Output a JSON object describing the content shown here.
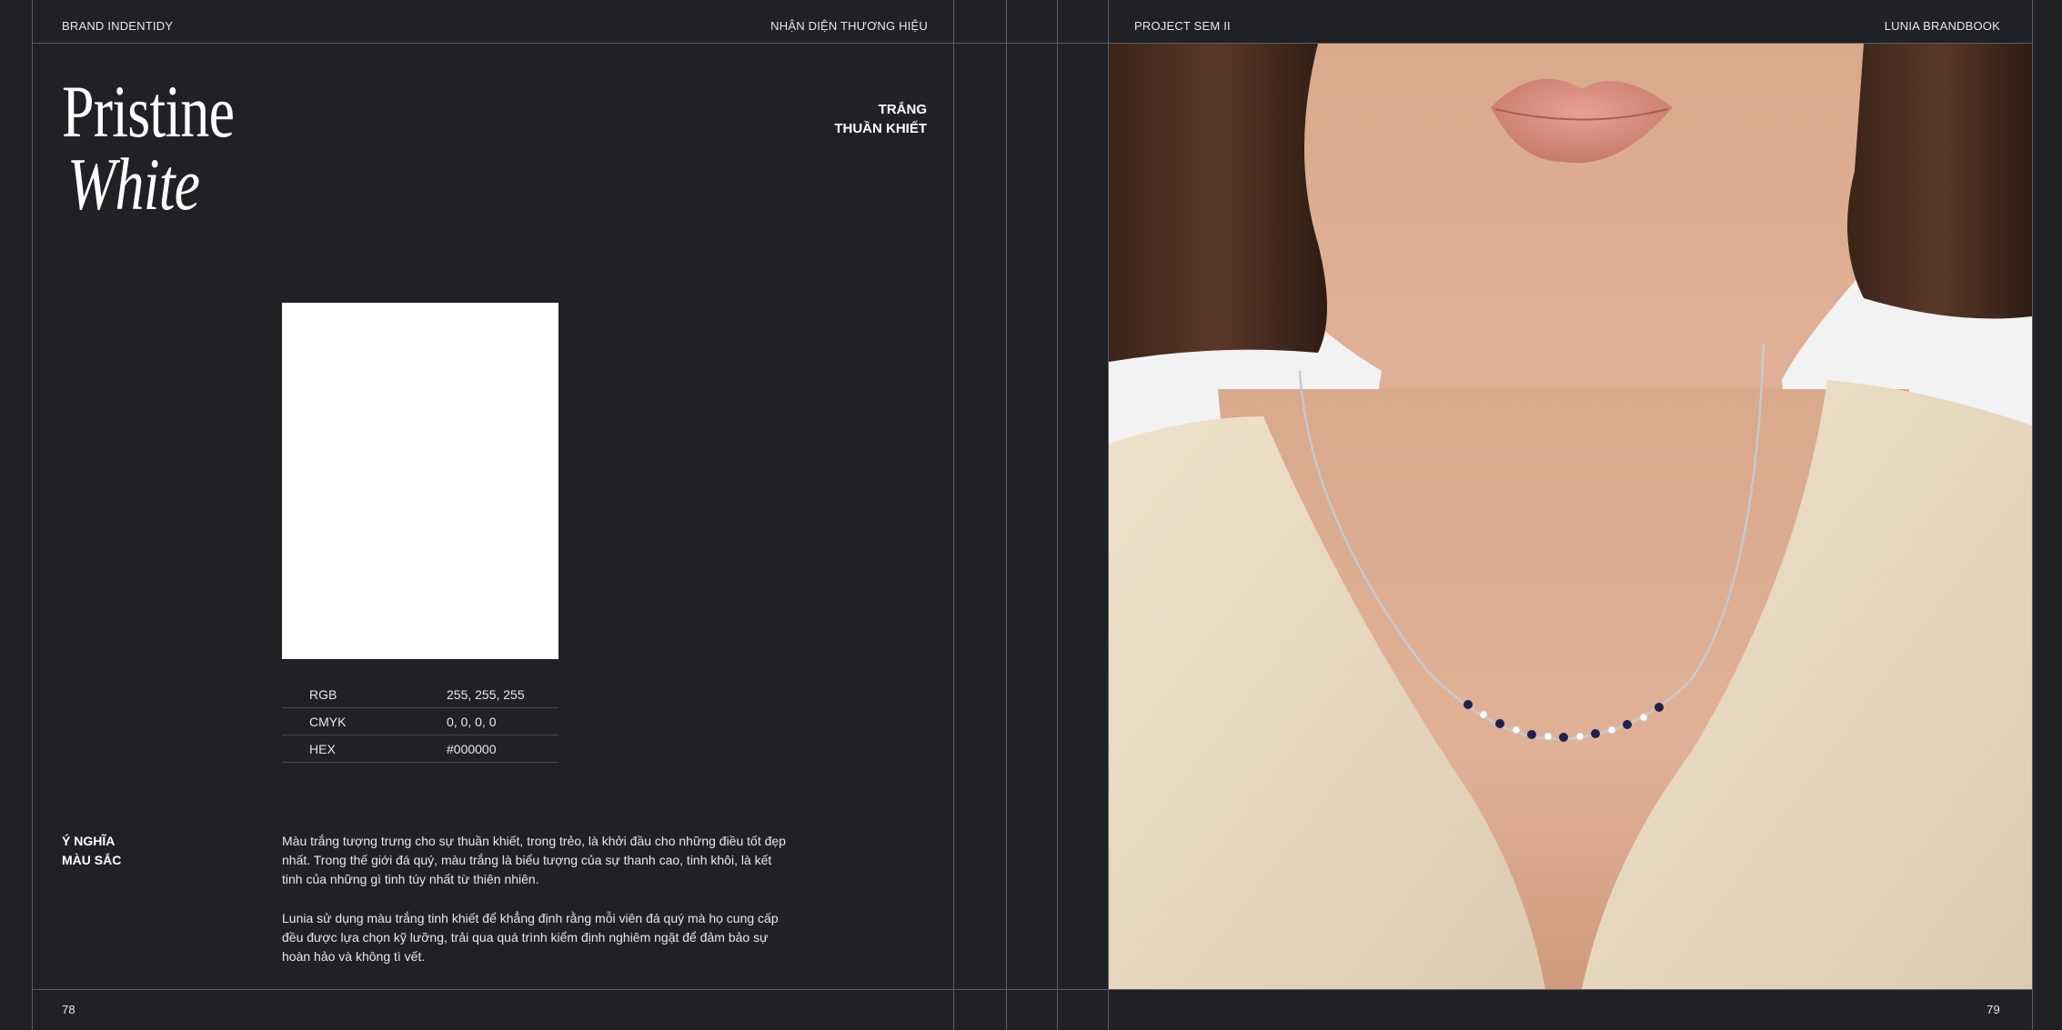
{
  "left_page": {
    "header_left": "BRAND INDENTIDY",
    "header_right": "NHẬN DIỆN THƯƠNG HIỆU",
    "title_line1": "Pristine",
    "title_line2": "White",
    "subtitle_line1": "TRẮNG",
    "subtitle_line2": "THUẦN KHIẾT",
    "swatch_color": "#ffffff",
    "specs": [
      {
        "label": "RGB",
        "value": "255, 255, 255"
      },
      {
        "label": "CMYK",
        "value": "0, 0, 0, 0"
      },
      {
        "label": "HEX",
        "value": "#000000"
      }
    ],
    "meaning_label_line1": "Ý NGHĨA",
    "meaning_label_line2": "MÀU SẮC",
    "paragraph1": "Màu trắng tượng trưng cho sự thuần khiết, trong trẻo, là khởi đầu cho những điều tốt đẹp nhất. Trong thế giới đá quý, màu trắng là biểu tượng của sự thanh cao, tinh khôi, là kết tinh của những gì tinh túy nhất từ thiên nhiên.",
    "paragraph2": "Lunia sử dụng màu trắng tinh khiết để khẳng định rằng mỗi viên đá quý mà họ cung cấp đều được lựa chọn kỹ lưỡng, trải qua quá trình kiểm định nghiêm ngặt để đảm bảo sự hoàn hảo và không tì vết.",
    "page_number": "78"
  },
  "right_page": {
    "header_left": "PROJECT SEM II",
    "header_right": "LUNIA BRANDBOOK",
    "page_number": "79"
  },
  "colors": {
    "background": "#202124",
    "rule": "#5c5d60",
    "text": "#ffffff"
  }
}
